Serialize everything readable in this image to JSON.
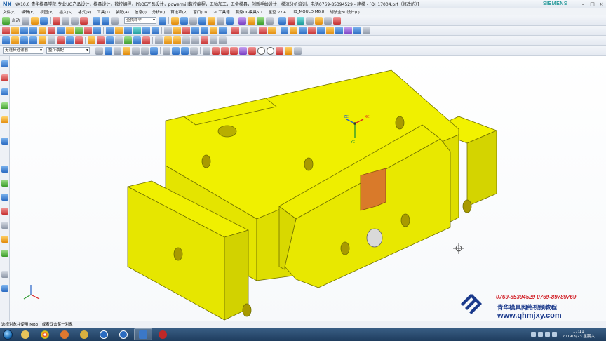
{
  "window": {
    "logo": "NX",
    "title": "NX10.0 青华模具学院 专业UG产品设计，模具设计，数控编程，PROE产品设计，powermill数控编程，五轴加工，五金模具，创新手绘设计，模流分析培训。电话0769-85394529 - 建模 - [QH17004.prt（修改的）]",
    "brand": "SIEMENS",
    "controls": [
      "–",
      "□",
      "×"
    ]
  },
  "menu": [
    "文件(F)",
    "编辑(E)",
    "视图(V)",
    "插入(S)",
    "格式(R)",
    "工具(T)",
    "装配(A)",
    "信息(I)",
    "分析(L)",
    "首选项(P)",
    "窗口(O)",
    "GC工具箱",
    "燕秀UG模具5.1",
    "星空 V7.4",
    "HB_MOULD M6.8",
    "胡波全3D设计(L)"
  ],
  "toolbar": {
    "start_label": "启动",
    "command_finder_placeholder": "查找命令",
    "selection_filter": "无选择过滤器",
    "assembly_scope": "整个装配"
  },
  "status": "选择对象并使用 MB3，或者双击某一对象",
  "watermark": {
    "phones": "0769-85394529  0769-89789769",
    "school": "青华模具网络视频教程",
    "url": "www.qhmjxy.com"
  },
  "wcs": {
    "zc": "ZC",
    "xc": "XC",
    "yc": "YC"
  },
  "taskbar": {
    "time": "17:11",
    "date": "2019/3/23 星期六"
  },
  "colors": {
    "part_top": "#f0f000",
    "part_side": "#e2e200",
    "part_dark": "#d2d200",
    "insert": "#d97a2a",
    "watermark_red": "#d2232a",
    "watermark_blue": "#1b3a8c",
    "nx_blue": "#1a5ea8",
    "siemens": "#2a9b9b"
  }
}
